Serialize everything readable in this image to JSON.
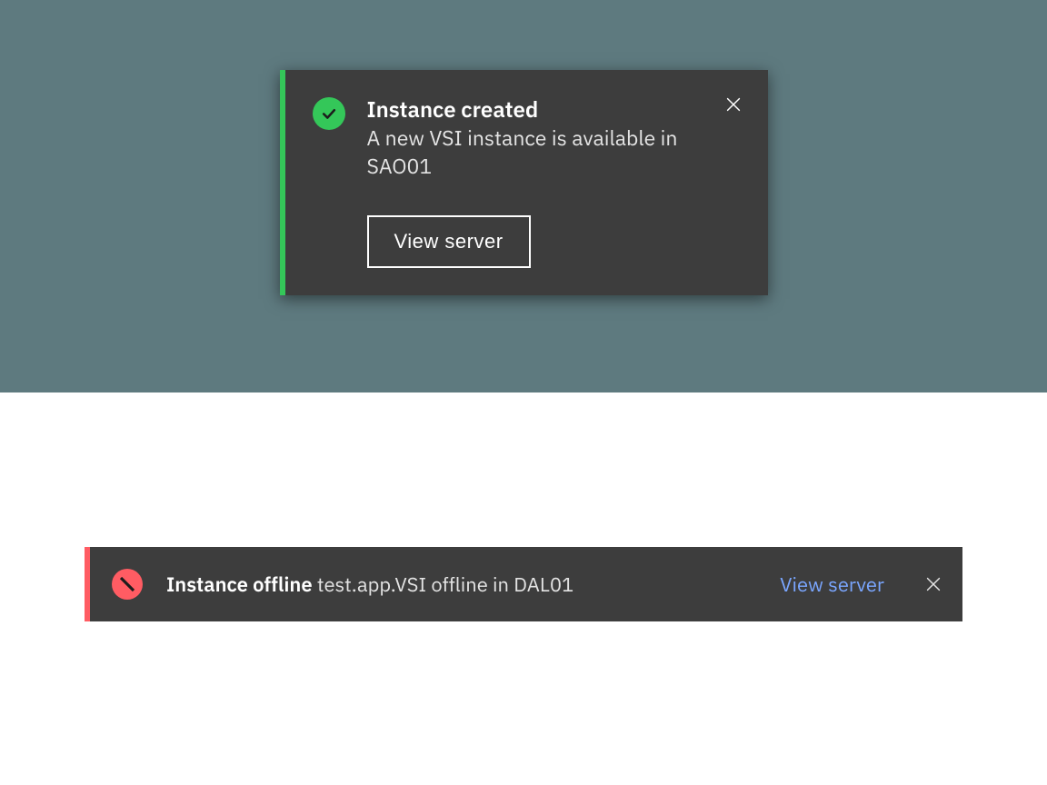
{
  "colors": {
    "success": "#34c759",
    "error": "#ff5c63",
    "surface": "#3d3d3d",
    "link": "#7aa6ff"
  },
  "toast_success": {
    "icon": "check-circle-icon",
    "title": "Instance created",
    "message": "A new VSI instance is available in SAO01",
    "action_label": "View server",
    "close_icon": "close-icon"
  },
  "inline_error": {
    "icon": "error-circle-icon",
    "title": "Instance offline",
    "message": "test.app.VSI offline in DAL01",
    "action_label": "View server",
    "close_icon": "close-icon"
  }
}
